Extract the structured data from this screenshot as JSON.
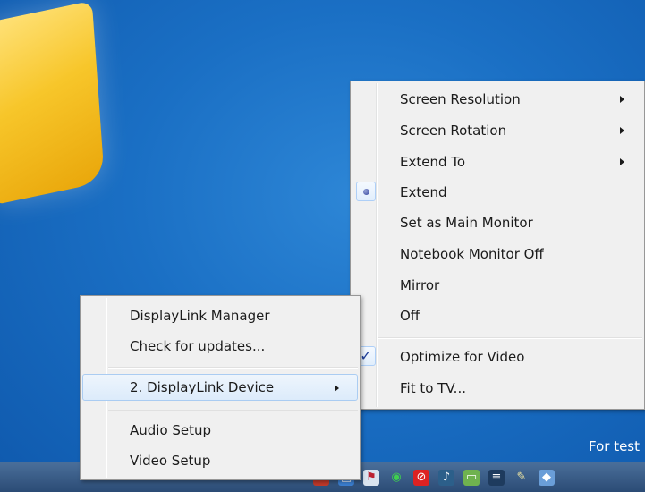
{
  "desktop": {
    "watermark_text": "For test"
  },
  "tray": {
    "icons": [
      "shield-icon",
      "network-icon",
      "flag-icon",
      "wireless-icon",
      "security-icon",
      "media-icon",
      "displaylink-icon",
      "bars-icon",
      "paint-icon",
      "app-icon"
    ]
  },
  "main_menu": {
    "items": [
      {
        "label": "DisplayLink Manager"
      },
      {
        "label": "Check for updates..."
      },
      {
        "label": "2. DisplayLink Device"
      },
      {
        "label": "Audio Setup"
      },
      {
        "label": "Video Setup"
      }
    ]
  },
  "sub_menu": {
    "items": [
      {
        "label": "Screen Resolution"
      },
      {
        "label": "Screen Rotation"
      },
      {
        "label": "Extend To"
      },
      {
        "label": "Extend"
      },
      {
        "label": "Set as Main Monitor"
      },
      {
        "label": "Notebook Monitor Off"
      },
      {
        "label": "Mirror"
      },
      {
        "label": "Off"
      },
      {
        "label": "Optimize for Video"
      },
      {
        "label": "Fit to TV..."
      }
    ]
  },
  "colors": {
    "desktop_blue": "#1a6fc4",
    "menu_bg": "#f0f0f0",
    "highlight_border": "#aaccf2"
  }
}
